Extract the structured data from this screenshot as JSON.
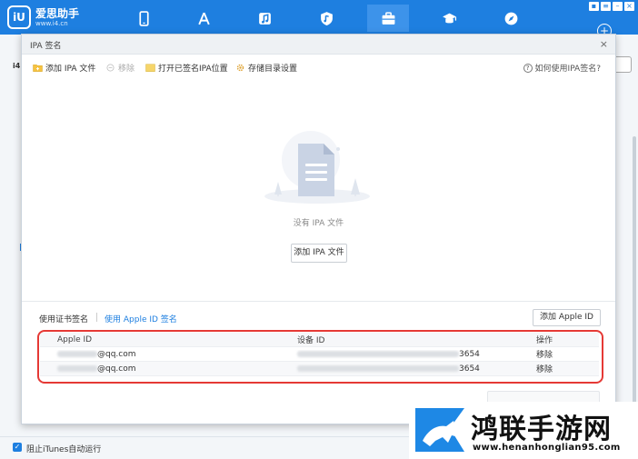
{
  "app": {
    "name": "爱思助手",
    "url": "www.i4.cn",
    "badge": "iU"
  },
  "nav": {
    "icons": [
      "phone-icon",
      "appstore-icon",
      "music-icon",
      "ringtone-icon",
      "toolbox-icon",
      "tutorial-icon",
      "browser-icon"
    ],
    "active": "toolbox-icon"
  },
  "background": {
    "left_label": "i4",
    "footer_checkbox": "阻止iTunes自动运行"
  },
  "dialog": {
    "title": "IPA 签名",
    "close": "×",
    "toolbar": {
      "add_ipa": "添加 IPA 文件",
      "remove": "移除",
      "open_signed": "打开已签名IPA位置",
      "storage_settings": "存储目录设置",
      "help": "如何使用IPA签名?"
    },
    "empty_label": "没有 IPA 文件",
    "add_ipa_button": "添加 IPA 文件",
    "tabs": {
      "cert": "使用证书签名",
      "appleid": "使用 Apple ID 签名"
    },
    "add_appleid_button": "添加 Apple ID",
    "table": {
      "headers": [
        "Apple ID",
        "设备 ID",
        "操作"
      ],
      "rows": [
        {
          "apple_id_suffix": "@qq.com",
          "device_suffix": "3654",
          "action": "移除"
        },
        {
          "apple_id_suffix": "@qq.com",
          "device_suffix": "3654",
          "action": "移除"
        }
      ]
    }
  },
  "watermark": {
    "title": "鸿联手游网",
    "url": "www.henanhonglian95.com"
  },
  "colors": {
    "brand": "#1e7fe0",
    "highlight": "#e53935"
  }
}
